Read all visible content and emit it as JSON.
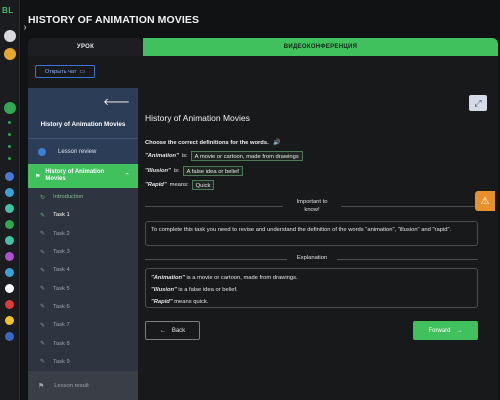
{
  "app": {
    "brand": "BL",
    "rail_colors": [
      "#ffffff",
      "#e7a92b",
      "#4a78d8",
      "#3aa1d8",
      "#44c2a6",
      "#2fa84f",
      "#b04fd0",
      "#3aa1d8",
      "#ffffff",
      "#e23a3a",
      "#f0c420",
      "#3a66c8"
    ]
  },
  "page": {
    "title": "HISTORY OF ANIMATION MOVIES"
  },
  "tabs": {
    "lesson": "УРОК",
    "video": "ВИДЕОКОНФЕРЕНЦИЯ"
  },
  "chat": {
    "open_label": "Открыть чат"
  },
  "sidebar": {
    "course_title": "History of Animation Movies",
    "review": "Lesson review",
    "active_section": "History of Animation Movies",
    "items": [
      {
        "label": "Introduction",
        "icon": "intro-icon"
      },
      {
        "label": "Task 1",
        "icon": "edit-icon"
      },
      {
        "label": "Task 2",
        "icon": "edit-icon"
      },
      {
        "label": "Task 3",
        "icon": "edit-icon"
      },
      {
        "label": "Task 4",
        "icon": "edit-icon"
      },
      {
        "label": "Task 5",
        "icon": "edit-icon"
      },
      {
        "label": "Task 6",
        "icon": "edit-icon"
      },
      {
        "label": "Task 7",
        "icon": "edit-icon"
      },
      {
        "label": "Task 8",
        "icon": "edit-icon"
      },
      {
        "label": "Task 9",
        "icon": "edit-icon"
      }
    ],
    "result": "Lesson result"
  },
  "content": {
    "title": "History of Animation Movies",
    "instruction": "Choose the correct definitions for the words.",
    "definitions": [
      {
        "word": "\"Animation\"",
        "verb": "is:",
        "answer": "A movie or cartoon, made from drawings"
      },
      {
        "word": "\"Illusion\"",
        "verb": "is:",
        "answer": "A false idea or belief"
      },
      {
        "word": "\"Rapid\"",
        "verb": "means:",
        "answer": "Quick"
      }
    ],
    "important_label_1": "Important to",
    "important_label_2": "know!",
    "important_text": "To complete this task you need to revise and understand the definition of the words \"animation\", \"illusion\" and \"rapid\".",
    "explanation_label": "Explanation",
    "explanation": [
      {
        "word": "\"Animation\"",
        "rest": " is a movie or cartoon, made from drawings."
      },
      {
        "word": "\"Illusion\"",
        "rest": " is a false idea or belief."
      },
      {
        "word": "\"Rapid\"",
        "rest": " means quick."
      }
    ]
  },
  "nav": {
    "back": "Back",
    "forward": "Forward"
  }
}
